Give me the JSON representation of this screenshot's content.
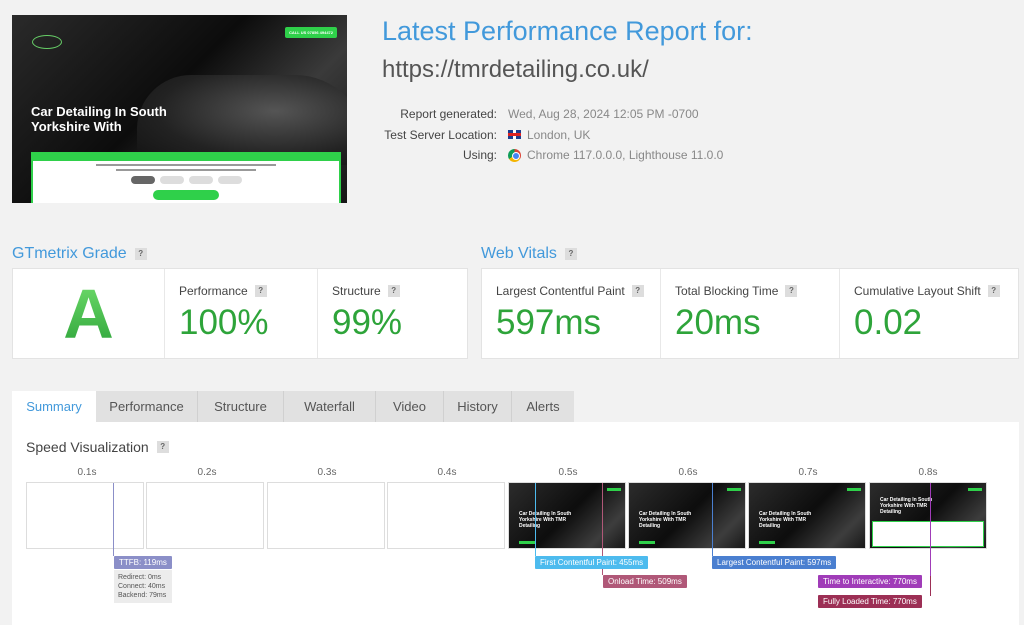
{
  "screenshot": {
    "headline": "Car Detailing In South Yorkshire With",
    "call_button": "CALL US 07856 494472"
  },
  "report": {
    "title": "Latest Performance Report for:",
    "url": "https://tmrdetailing.co.uk/",
    "generated_label": "Report generated:",
    "generated_value": "Wed, Aug 28, 2024 12:05 PM -0700",
    "location_label": "Test Server Location:",
    "location_value": "London, UK",
    "using_label": "Using:",
    "using_value": "Chrome 117.0.0.0, Lighthouse 11.0.0"
  },
  "grade": {
    "title": "GTmetrix Grade",
    "letter": "A",
    "performance_label": "Performance",
    "performance_value": "100%",
    "structure_label": "Structure",
    "structure_value": "99%"
  },
  "vitals": {
    "title": "Web Vitals",
    "lcp_label": "Largest Contentful Paint",
    "lcp_value": "597ms",
    "tbt_label": "Total Blocking Time",
    "tbt_value": "20ms",
    "cls_label": "Cumulative Layout Shift",
    "cls_value": "0.02"
  },
  "help_glyph": "?",
  "tabs": [
    "Summary",
    "Performance",
    "Structure",
    "Waterfall",
    "Video",
    "History",
    "Alerts"
  ],
  "speed": {
    "title": "Speed Visualization",
    "times": [
      "0.1s",
      "0.2s",
      "0.3s",
      "0.4s",
      "0.5s",
      "0.6s",
      "0.7s",
      "0.8s"
    ],
    "frame_text": "Car Detailing In South Yorkshire With TMR Detailing",
    "ttfb": "TTFB: 119ms",
    "redirect": "Redirect: 0ms",
    "connect": "Connect: 40ms",
    "backend": "Backend: 79ms",
    "fcp": "First Contentful Paint: 455ms",
    "onload": "Onload Time: 509ms",
    "lcp": "Largest Contentful Paint: 597ms",
    "tti": "Time to Interactive: 770ms",
    "fully": "Fully Loaded Time: 770ms"
  },
  "colors": {
    "accent": "#4299db",
    "grade_green": "#2ea43a",
    "ttfb": "#8b8fc8",
    "fcp": "#4dbbee",
    "onload": "#b05878",
    "lcp": "#4a7fd0",
    "tti": "#a03cb8",
    "fully": "#9c2f55"
  }
}
